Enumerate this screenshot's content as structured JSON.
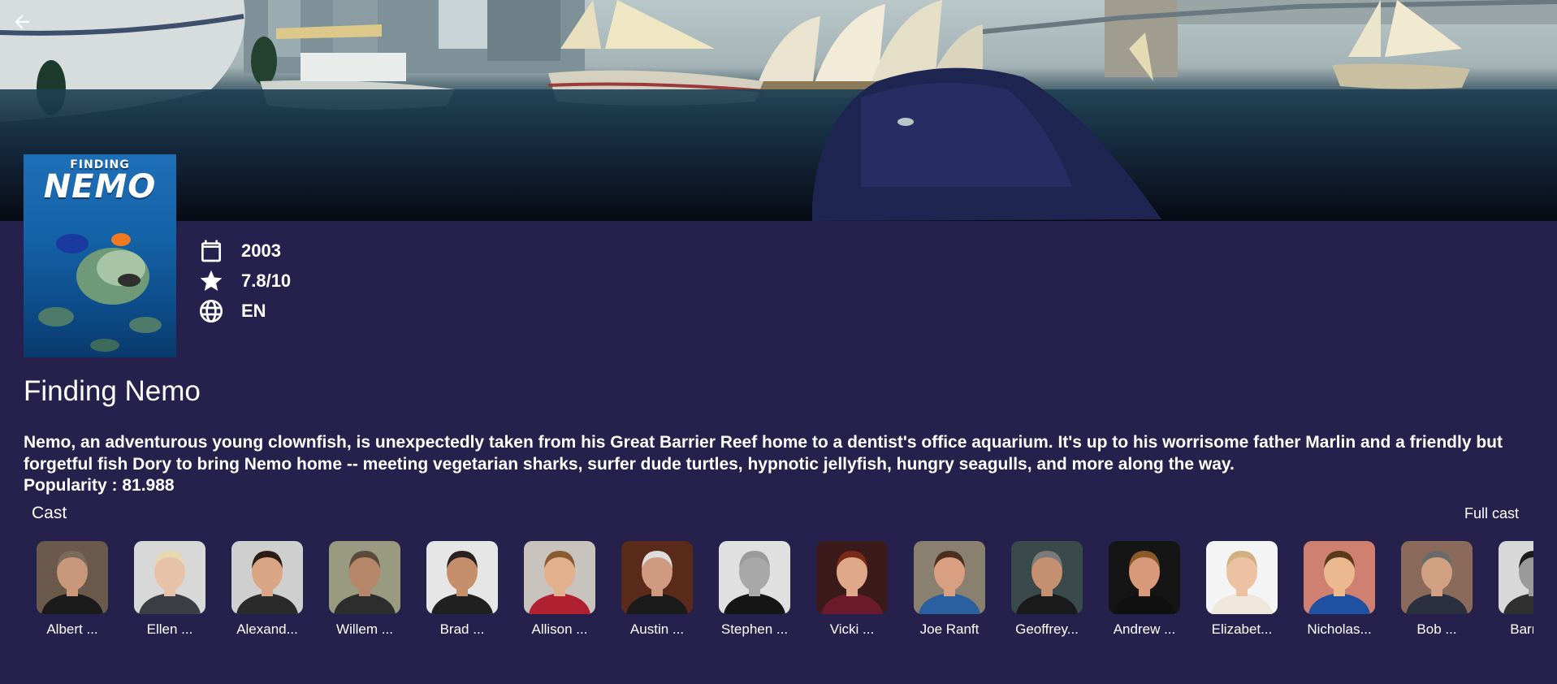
{
  "nav": {
    "back_icon": "arrow-back-icon"
  },
  "movie": {
    "title": "Finding Nemo",
    "poster": {
      "small_text": "FINDING",
      "big_text": "NEMO"
    },
    "year": "2003",
    "rating": "7.8/10",
    "language": "EN",
    "overview": "Nemo, an adventurous young clownfish, is unexpectedly taken from his Great Barrier Reef home to a dentist's office aquarium. It's up to his worrisome father Marlin and a friendly but forgetful fish Dory to bring Nemo home -- meeting vegetarian sharks, surfer dude turtles, hypnotic jellyfish, hungry seagulls, and more along the way.",
    "popularity": "Popularity : 81.988"
  },
  "icons": {
    "year": "calendar-icon",
    "rating": "star-icon",
    "language": "globe-icon"
  },
  "cast": {
    "label": "Cast",
    "full_cast_label": "Full cast",
    "members": [
      {
        "name": "Albert ...",
        "bg": "#6b5a4c",
        "skin": "#c9977a",
        "shirt": "#1b1b1b",
        "hair": "#7a6a5a"
      },
      {
        "name": "Ellen ...",
        "bg": "#d8d8d8",
        "skin": "#e8c2a8",
        "shirt": "#3a3d44",
        "hair": "#e6d8b0"
      },
      {
        "name": "Alexand...",
        "bg": "#cfcfcf",
        "skin": "#d9a584",
        "shirt": "#2a2a2a",
        "hair": "#2b1d14"
      },
      {
        "name": "Willem ...",
        "bg": "#9a9a80",
        "skin": "#b68668",
        "shirt": "#2d2d2d",
        "hair": "#5a4a3a"
      },
      {
        "name": "Brad ...",
        "bg": "#e6e6e6",
        "skin": "#c68f6c",
        "shirt": "#202020",
        "hair": "#2a2020"
      },
      {
        "name": "Allison ...",
        "bg": "#c9c3bd",
        "skin": "#e3b08e",
        "shirt": "#b02030",
        "hair": "#8a5a30"
      },
      {
        "name": "Austin ...",
        "bg": "#5a2a1a",
        "skin": "#d09a80",
        "shirt": "#1a1a1a",
        "hair": "#dddddd"
      },
      {
        "name": "Stephen ...",
        "bg": "#e0e0e0",
        "skin": "#a8a8a8",
        "shirt": "#151515",
        "hair": "#9a9a9a"
      },
      {
        "name": "Vicki ...",
        "bg": "#3a1a1a",
        "skin": "#e0a88a",
        "shirt": "#6a1a2a",
        "hair": "#7a2818"
      },
      {
        "name": "Joe Ranft",
        "bg": "#8a8070",
        "skin": "#d8a080",
        "shirt": "#2a60a0",
        "hair": "#4a3020"
      },
      {
        "name": "Geoffrey...",
        "bg": "#3a4a4a",
        "skin": "#c49070",
        "shirt": "#1a1a1a",
        "hair": "#7a7a7a"
      },
      {
        "name": "Andrew ...",
        "bg": "#151515",
        "skin": "#d89a78",
        "shirt": "#101010",
        "hair": "#8a5a2a"
      },
      {
        "name": "Elizabet...",
        "bg": "#f4f4f4",
        "skin": "#ecc2a2",
        "shirt": "#efe6dc",
        "hair": "#d0b080"
      },
      {
        "name": "Nicholas...",
        "bg": "#d08070",
        "skin": "#ecb890",
        "shirt": "#2050a0",
        "hair": "#5a3a1a"
      },
      {
        "name": "Bob ...",
        "bg": "#8a6a5a",
        "skin": "#d0a080",
        "shirt": "#2a3040",
        "hair": "#6a6a6a"
      },
      {
        "name": "Barry ...",
        "bg": "#d8d8d8",
        "skin": "#9a9a9a",
        "shirt": "#303030",
        "hair": "#1a1a1a"
      }
    ]
  }
}
